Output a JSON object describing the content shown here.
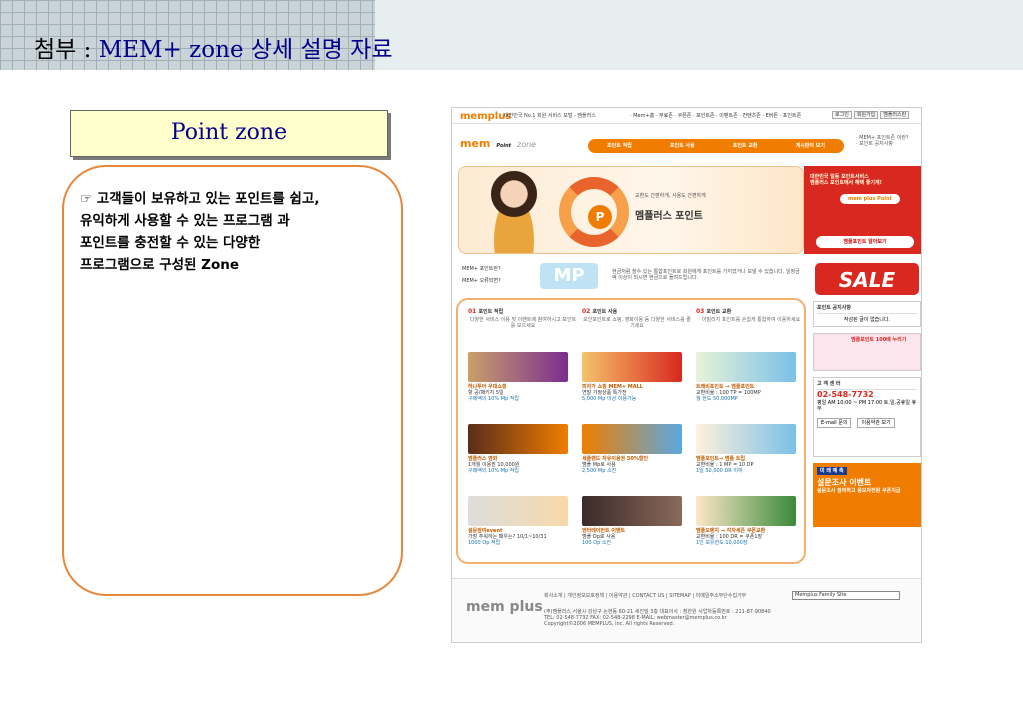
{
  "slide": {
    "title_ko_prefix": "첨부 : ",
    "title_en": "MEM+ zone ",
    "title_ko_suffix": "상세 설명 자료",
    "section_label": "Point zone",
    "description_lines": [
      "☞ 고객들이 보유하고 있는 포인트를 쉽고,",
      "유익하게 사용할 수 있는 프로그램 과",
      "포인트를 충전할 수 있는 다양한",
      "프로그램으로 구성된 Zone"
    ]
  },
  "site": {
    "logo": "memplus",
    "tagline": "대한민국 No.1 회원 서비스 포털 - 멤플러스",
    "global_nav": "· Mem+홈 · 무료존 · 쿠폰존 · 포인트존 · 이벤트존 · 컨텐츠존 · E버튼 · 포인트존",
    "global_buttons": [
      "로그인",
      "회원가입",
      "멤플러스란"
    ],
    "brand_prefix": "mem",
    "brand_main": "Point",
    "brand_suffix": "zone",
    "tabs": [
      "포인트 적립",
      "포인트 사용",
      "포인트 교환",
      "게시판이 보기"
    ],
    "side_links": [
      "· MEM+ 포인트존 이란?",
      "· 포인트 공지사항"
    ],
    "hero": {
      "headline": "교환도 간편하게, 사용도 간편하게",
      "title": "멤플러스 포인트"
    },
    "promo": {
      "line1": "대한민국 일등 포인트서비스",
      "line2": "멤플러스 포인트에서 혜택 좋기게!",
      "badge": "mem plus Point",
      "button": "멤플포인트 알아보기"
    },
    "mp_links": [
      "MEM+ 포인트란?",
      "MEM+ 오류되면?"
    ],
    "mp_badge": "MP",
    "mp_desc": "현금처럼 쓸수 있는 통합포인트로 회원에게 포인트를 가지었거나 보낼 수 있습니다. 일정금액 이상이 되시면 현금으로 돌려드립니다.",
    "sale_text": "SALE",
    "columns": [
      {
        "num": "01",
        "title": "포인트 적립",
        "sub": "다양한 서비스 이용 및 이벤트에 참여하시고 포인트를 모으세요"
      },
      {
        "num": "02",
        "title": "포인트 사용",
        "sub": "모인포인트로 쇼핑, 영화이용 등 다양한 서비스를 즐기세요"
      },
      {
        "num": "03",
        "title": "포인트 교환",
        "sub": "이밀리지 포인트를 손쉽게 통합하여 이용하세요"
      }
    ],
    "cards": [
      {
        "title": "하나투어 우대쇼핑",
        "line": "항 공/패키지 5일",
        "gain": "구매액의 10% Mp 적립"
      },
      {
        "title": "피자가 쇼핑 MEM+ MALL",
        "line": "연말 가정상품 특가전",
        "gain": "5,000 Mp 이상 이용가능"
      },
      {
        "title": "트래비포인트 → 멤플포인트",
        "line": "교환비율 : 100 TP = 100MP",
        "gain": "월 한도 50,000MP"
      },
      {
        "title": "멤플러스 영화",
        "line": "1개월 이용권 10,000원",
        "gain": "구매액의 10% Mp 적립"
      },
      {
        "title": "세플랜드 자유이용권 50%할인",
        "line": "멤플 Mp로 사용",
        "gain": "2,500 Mp 소진"
      },
      {
        "title": "멤플포인트→ 멤플 트립",
        "line": "교환비율 : 1 MP = 10 DP",
        "gain": "1일 50,000 DR 이하"
      },
      {
        "title": "설문참여event",
        "line": "가장 추워하는 패우는? 10/1~10/31",
        "gain": "1000 Op 적립"
      },
      {
        "title": "엔터테이먼트 이벤트",
        "line": "멤플 Op로 사용",
        "gain": "100 Op 소진"
      },
      {
        "title": "멤플오렌지 → 각자세픈 쿠폰교환",
        "line": "교환비율 : 100 DR = 쿠폰1장",
        "gain": "1인 보유한도 10,000장"
      }
    ],
    "notice": {
      "title": "포인트 공지사항",
      "empty": "작성된 글이 없습니다."
    },
    "ad": "멤플포인트 100배 누리기",
    "cs": {
      "title": "고 객 센 터",
      "phone": "02-548-7732",
      "hours": "평일 AM 10:00 ~ PM 17:00 토,일,공휴일 휴무",
      "buttons": [
        "E-mail 문의",
        "이용약관 보기"
      ]
    },
    "survey": {
      "badge": "미 래 예 측",
      "title": "설문조사 이벤트",
      "sub": "설문조사 참여하고 응모자전원 쿠폰지급"
    },
    "footer": {
      "links": "회사소개 | 개인정보보호정책 | 이용약관 | CONTACT US | SITEMAP | 이메일주소무단수집거부",
      "company": "(주)멤플러스 서울시 강남구 논현동 60-21 세진빌 3층 대표이사 : 정한원 사업자등록번호 : 211-87-90840",
      "contact": "TEL: 02-548-7732 FAX: 02-548-2298 E-MAIL: webmaster@memplus.co.kr",
      "copyright": "Copyright©2006 MEMPLUS, Inc. All rights Reserved.",
      "family_select": "Memplus Family Site",
      "logo": "mem plus"
    }
  }
}
